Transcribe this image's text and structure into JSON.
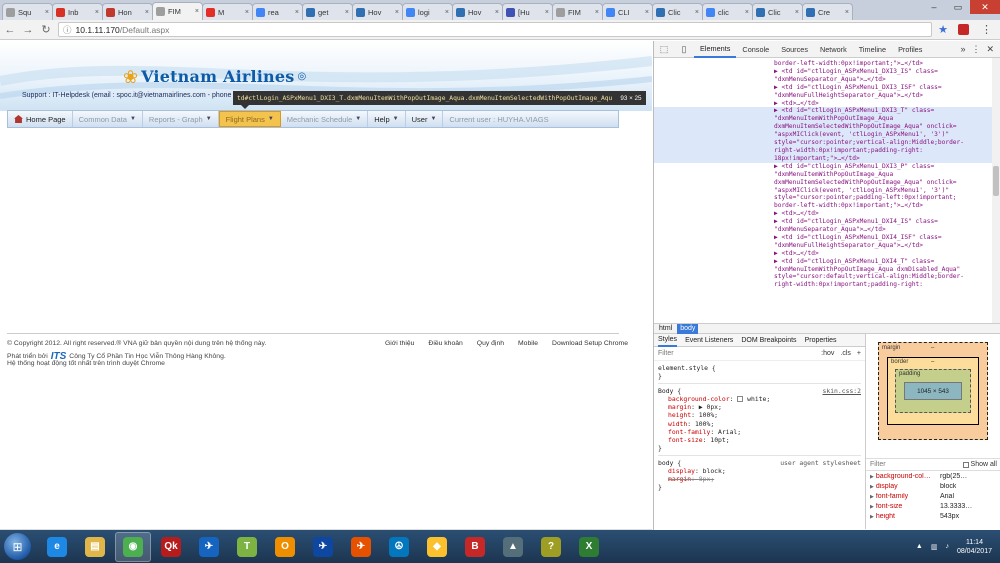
{
  "browser": {
    "tabs": [
      {
        "label": "Squ",
        "icon": "page-icon",
        "color": "#9e9e9e"
      },
      {
        "label": "Inb",
        "icon": "gmail-icon",
        "color": "#d93025"
      },
      {
        "label": "Hon",
        "icon": "flag-icon",
        "color": "#c0392b"
      },
      {
        "label": "FIM",
        "icon": "page-icon",
        "color": "#9e9e9e",
        "active": true
      },
      {
        "label": "M",
        "icon": "youtube-icon",
        "color": "#e52d27"
      },
      {
        "label": "rea",
        "icon": "google-icon",
        "color": "#4285f4"
      },
      {
        "label": "get",
        "icon": "globe-icon",
        "color": "#2f6fb2"
      },
      {
        "label": "Hov",
        "icon": "globe-icon",
        "color": "#2f6fb2"
      },
      {
        "label": "logi",
        "icon": "google-icon",
        "color": "#4285f4"
      },
      {
        "label": "Hov",
        "icon": "globe-icon",
        "color": "#2f6fb2"
      },
      {
        "label": "[Hu",
        "icon": "globe-icon",
        "color": "#3f51b5"
      },
      {
        "label": "FIM",
        "icon": "page-icon",
        "color": "#9e9e9e"
      },
      {
        "label": "CLI",
        "icon": "google-icon",
        "color": "#4285f4"
      },
      {
        "label": "Clic",
        "icon": "globe-icon",
        "color": "#2f6fb2"
      },
      {
        "label": "clic",
        "icon": "google-icon",
        "color": "#4285f4"
      },
      {
        "label": "Clic",
        "icon": "globe-icon",
        "color": "#2f6fb2"
      },
      {
        "label": "Cre",
        "icon": "globe-icon",
        "color": "#2f6fb2"
      }
    ],
    "url_host": "10.1.11.170",
    "url_path": "/Default.aspx"
  },
  "site": {
    "brand": "Vietnam Airlines",
    "support_label": "Support : IT-Helpdesk (email : spoc.it@vietnamairlines.com - phone",
    "tooltip_selector": "td#ctlLogin_ASPxMenu1_DXI3_T.dxmMenuItemWithPopOutImage_Aqua.dxmMenuItemSelectedWithPopOutImage_Aqu",
    "tooltip_size": "93 × 25",
    "menu": [
      {
        "label": "Home Page",
        "disabled": false,
        "dropdown": false,
        "home": true
      },
      {
        "label": "Common Data",
        "disabled": true,
        "dropdown": true
      },
      {
        "label": "Reports - Graph",
        "disabled": true,
        "dropdown": true
      },
      {
        "label": "Flight Plans",
        "disabled": true,
        "dropdown": true,
        "highlight": true
      },
      {
        "label": "Mechanic Schedule",
        "disabled": true,
        "dropdown": true
      },
      {
        "label": "Help",
        "disabled": false,
        "dropdown": true
      },
      {
        "label": "User",
        "disabled": false,
        "dropdown": true
      },
      {
        "label": "Current user : HUYHA.VIAGS",
        "disabled": true,
        "dropdown": false
      }
    ],
    "copyright": "© Copyright 2012. All right reserved.® VNA giữ bản quyền nội dung trên hệ thống này.",
    "footer_links": [
      "Giới thiệu",
      "Điều khoản",
      "Quy định",
      "Mobile",
      "Download Setup Chrome"
    ],
    "dev_prefix": "Phát triển bởi",
    "dev_logo": "ITS",
    "dev_company": "Công Ty Cổ Phần Tin Học Viễn Thông Hàng Không.",
    "browser_note": "Hệ thống hoạt động tốt nhất trên trình duyệt Chrome"
  },
  "devtools": {
    "tabs": [
      "Elements",
      "Console",
      "Sources",
      "Network",
      "Timeline",
      "Profiles"
    ],
    "active_tab": "Elements",
    "more": "»",
    "element_lines": [
      {
        "text": "border-left-width:0px!important;\">…</td>",
        "sel": false
      },
      {
        "text": "▶ <td id=\"ctlLogin_ASPxMenu1_DXI3_IS\" class=",
        "sel": false
      },
      {
        "text": "\"dxmMenuSeparator_Aqua\">…</td>",
        "sel": false
      },
      {
        "text": "▶ <td id=\"ctlLogin_ASPxMenu1_DXI3_ISF\" class=",
        "sel": false
      },
      {
        "text": "\"dxmMenuFullHeightSeparator_Aqua\">…</td>",
        "sel": false
      },
      {
        "text": "▶ <td>…</td>",
        "sel": false
      },
      {
        "text": "▶ <td id=\"ctlLogin_ASPxMenu1_DXI3_T\" class=",
        "sel": true
      },
      {
        "text": "\"dxmMenuItemWithPopOutImage_Aqua",
        "sel": true
      },
      {
        "text": "dxmMenuItemSelectedWithPopOutImage_Aqua\" onclick=",
        "sel": true
      },
      {
        "text": "\"aspxMIClick(event, 'ctlLogin_ASPxMenu1', '3')\"",
        "sel": true
      },
      {
        "text": "style=\"cursor:pointer;vertical-align:Middle;border-",
        "sel": true
      },
      {
        "text": "right-width:0px!important;padding-right:",
        "sel": true
      },
      {
        "text": "18px!important;\">…</td>",
        "sel": true
      },
      {
        "text": "▶ <td id=\"ctlLogin_ASPxMenu1_DXI3_P\" class=",
        "sel": false
      },
      {
        "text": "\"dxmMenuItemWithPopOutImage_Aqua",
        "sel": false
      },
      {
        "text": "dxmMenuItemSelectedWithPopOutImage_Aqua\" onclick=",
        "sel": false
      },
      {
        "text": "\"aspxMIClick(event, 'ctlLogin_ASPxMenu1', '3')\"",
        "sel": false
      },
      {
        "text": "style=\"cursor:pointer;padding-left:0px!important;",
        "sel": false
      },
      {
        "text": "border-left-width:0px!important;\">…</td>",
        "sel": false
      },
      {
        "text": "▶ <td>…</td>",
        "sel": false
      },
      {
        "text": "▶ <td id=\"ctlLogin_ASPxMenu1_DXI4_IS\" class=",
        "sel": false
      },
      {
        "text": "\"dxmMenuSeparator_Aqua\">…</td>",
        "sel": false
      },
      {
        "text": "▶ <td id=\"ctlLogin_ASPxMenu1_DXI4_ISF\" class=",
        "sel": false
      },
      {
        "text": "\"dxmMenuFullHeightSeparator_Aqua\">…</td>",
        "sel": false
      },
      {
        "text": "▶ <td>…</td>",
        "sel": false
      },
      {
        "text": "▶ <td id=\"ctlLogin_ASPxMenu1_DXI4_T\" class=",
        "sel": false
      },
      {
        "text": "\"dxmMenuItemWithPopOutImage_Aqua dxmDisabled_Aqua\"",
        "sel": false
      },
      {
        "text": "style=\"cursor:default;vertical-align:Middle;border-",
        "sel": false
      },
      {
        "text": "right-width:0px!important;padding-right:",
        "sel": false
      }
    ],
    "breadcrumbs": [
      "html",
      "body"
    ],
    "active_crumb": "body",
    "subtabs": [
      "Styles",
      "Event Listeners",
      "DOM Breakpoints",
      "Properties"
    ],
    "filter_placeholder": "Filter",
    "hov": ":hov",
    "cls": ".cls",
    "plus": "+",
    "element_style": "element.style {",
    "rule1_selector": "Body {",
    "rule1_src": "skin.css:2",
    "rule1_props": [
      {
        "name": "background-color",
        "value": "white;",
        "swatch": true
      },
      {
        "name": "margin",
        "value": "▶ 0px;"
      },
      {
        "name": "height",
        "value": "100%;"
      },
      {
        "name": "width",
        "value": "100%;"
      },
      {
        "name": "font-family",
        "value": "Arial;"
      },
      {
        "name": "font-size",
        "value": "10pt;"
      }
    ],
    "rule2_selector": "body {",
    "rule2_src": "user agent stylesheet",
    "rule2_props": [
      {
        "name": "display",
        "value": "block;"
      },
      {
        "name": "margin",
        "value": "8px;",
        "strike": true
      }
    ],
    "close_brace": "}",
    "box": {
      "margin_label": "margin",
      "border_label": "border",
      "padding_label": "padding",
      "content": "1045 × 543",
      "dash": "–"
    },
    "computed_filter": "Filter",
    "show_all": "Show all",
    "computed": [
      {
        "k": "background-col…",
        "v": "rgb(25…"
      },
      {
        "k": "display",
        "v": "block"
      },
      {
        "k": "font-family",
        "v": "Arial"
      },
      {
        "k": "font-size",
        "v": "13.3333…"
      },
      {
        "k": "height",
        "v": "543px"
      }
    ]
  },
  "taskbar": {
    "apps": [
      {
        "icon": "ie-icon",
        "color": "#1e88e5",
        "glyph": "e"
      },
      {
        "icon": "folder-icon",
        "color": "#e0b64a",
        "glyph": "▤"
      },
      {
        "icon": "chrome-icon",
        "color": "#4caf50",
        "glyph": "◉",
        "active": true
      },
      {
        "icon": "app-red-icon",
        "color": "#b71c1c",
        "glyph": "Qk"
      },
      {
        "icon": "plane-icon",
        "color": "#1565c0",
        "glyph": "✈"
      },
      {
        "icon": "ticket-icon",
        "color": "#7cb342",
        "glyph": "T"
      },
      {
        "icon": "outlook-icon",
        "color": "#ef8f00",
        "glyph": "O"
      },
      {
        "icon": "aircraft-icon",
        "color": "#0d47a1",
        "glyph": "✈"
      },
      {
        "icon": "plane-orange-icon",
        "color": "#e65100",
        "glyph": "✈"
      },
      {
        "icon": "peace-icon",
        "color": "#0277bd",
        "glyph": "☮"
      },
      {
        "icon": "palette-icon",
        "color": "#fbc02d",
        "glyph": "◆"
      },
      {
        "icon": "book-icon",
        "color": "#c62828",
        "glyph": "B"
      },
      {
        "icon": "triangle-icon",
        "color": "#546e7a",
        "glyph": "▲"
      },
      {
        "icon": "key-icon",
        "color": "#9e9d24",
        "glyph": "?"
      },
      {
        "icon": "excel-icon",
        "color": "#2e7d32",
        "glyph": "X"
      }
    ],
    "time": "11:14",
    "date": "08/04/2017"
  }
}
